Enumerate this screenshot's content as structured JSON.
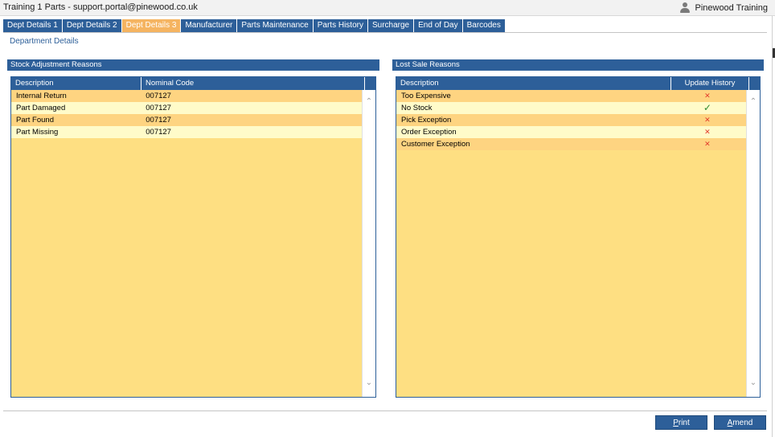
{
  "window": {
    "title": "Training 1 Parts - support.portal@pinewood.co.uk",
    "user": "Pinewood Training"
  },
  "tabs": [
    {
      "label": "Dept Details 1",
      "active": false
    },
    {
      "label": "Dept Details 2",
      "active": false
    },
    {
      "label": "Dept Details 3",
      "active": true
    },
    {
      "label": "Manufacturer",
      "active": false
    },
    {
      "label": "Parts Maintenance",
      "active": false
    },
    {
      "label": "Parts History",
      "active": false
    },
    {
      "label": "Surcharge",
      "active": false
    },
    {
      "label": "End of Day",
      "active": false
    },
    {
      "label": "Barcodes",
      "active": false
    }
  ],
  "section_title": "Department Details",
  "stock_adjustment": {
    "title": "Stock Adjustment Reasons",
    "columns": [
      "Description",
      "Nominal Code"
    ],
    "rows": [
      {
        "description": "Internal Return",
        "nominal_code": "007127"
      },
      {
        "description": "Part Damaged",
        "nominal_code": "007127"
      },
      {
        "description": "Part Found",
        "nominal_code": "007127"
      },
      {
        "description": "Part Missing",
        "nominal_code": "007127"
      }
    ]
  },
  "lost_sale": {
    "title": "Lost Sale Reasons",
    "columns": [
      "Description",
      "Update History"
    ],
    "rows": [
      {
        "description": "Too Expensive",
        "update_history": false
      },
      {
        "description": "No Stock",
        "update_history": true
      },
      {
        "description": "Pick Exception",
        "update_history": false
      },
      {
        "description": "Order Exception",
        "update_history": false
      },
      {
        "description": "Customer Exception",
        "update_history": false
      }
    ]
  },
  "buttons": {
    "print": {
      "underlined": "P",
      "rest": "rint"
    },
    "amend": {
      "underlined": "A",
      "rest": "mend"
    }
  },
  "icons": {
    "user": "user-icon",
    "check": "check-icon",
    "cross": "cross-icon"
  },
  "colors": {
    "accent": "#2d5f99",
    "active_tab": "#f5b461",
    "row_odd": "#fed481",
    "row_even": "#fffbc9"
  }
}
